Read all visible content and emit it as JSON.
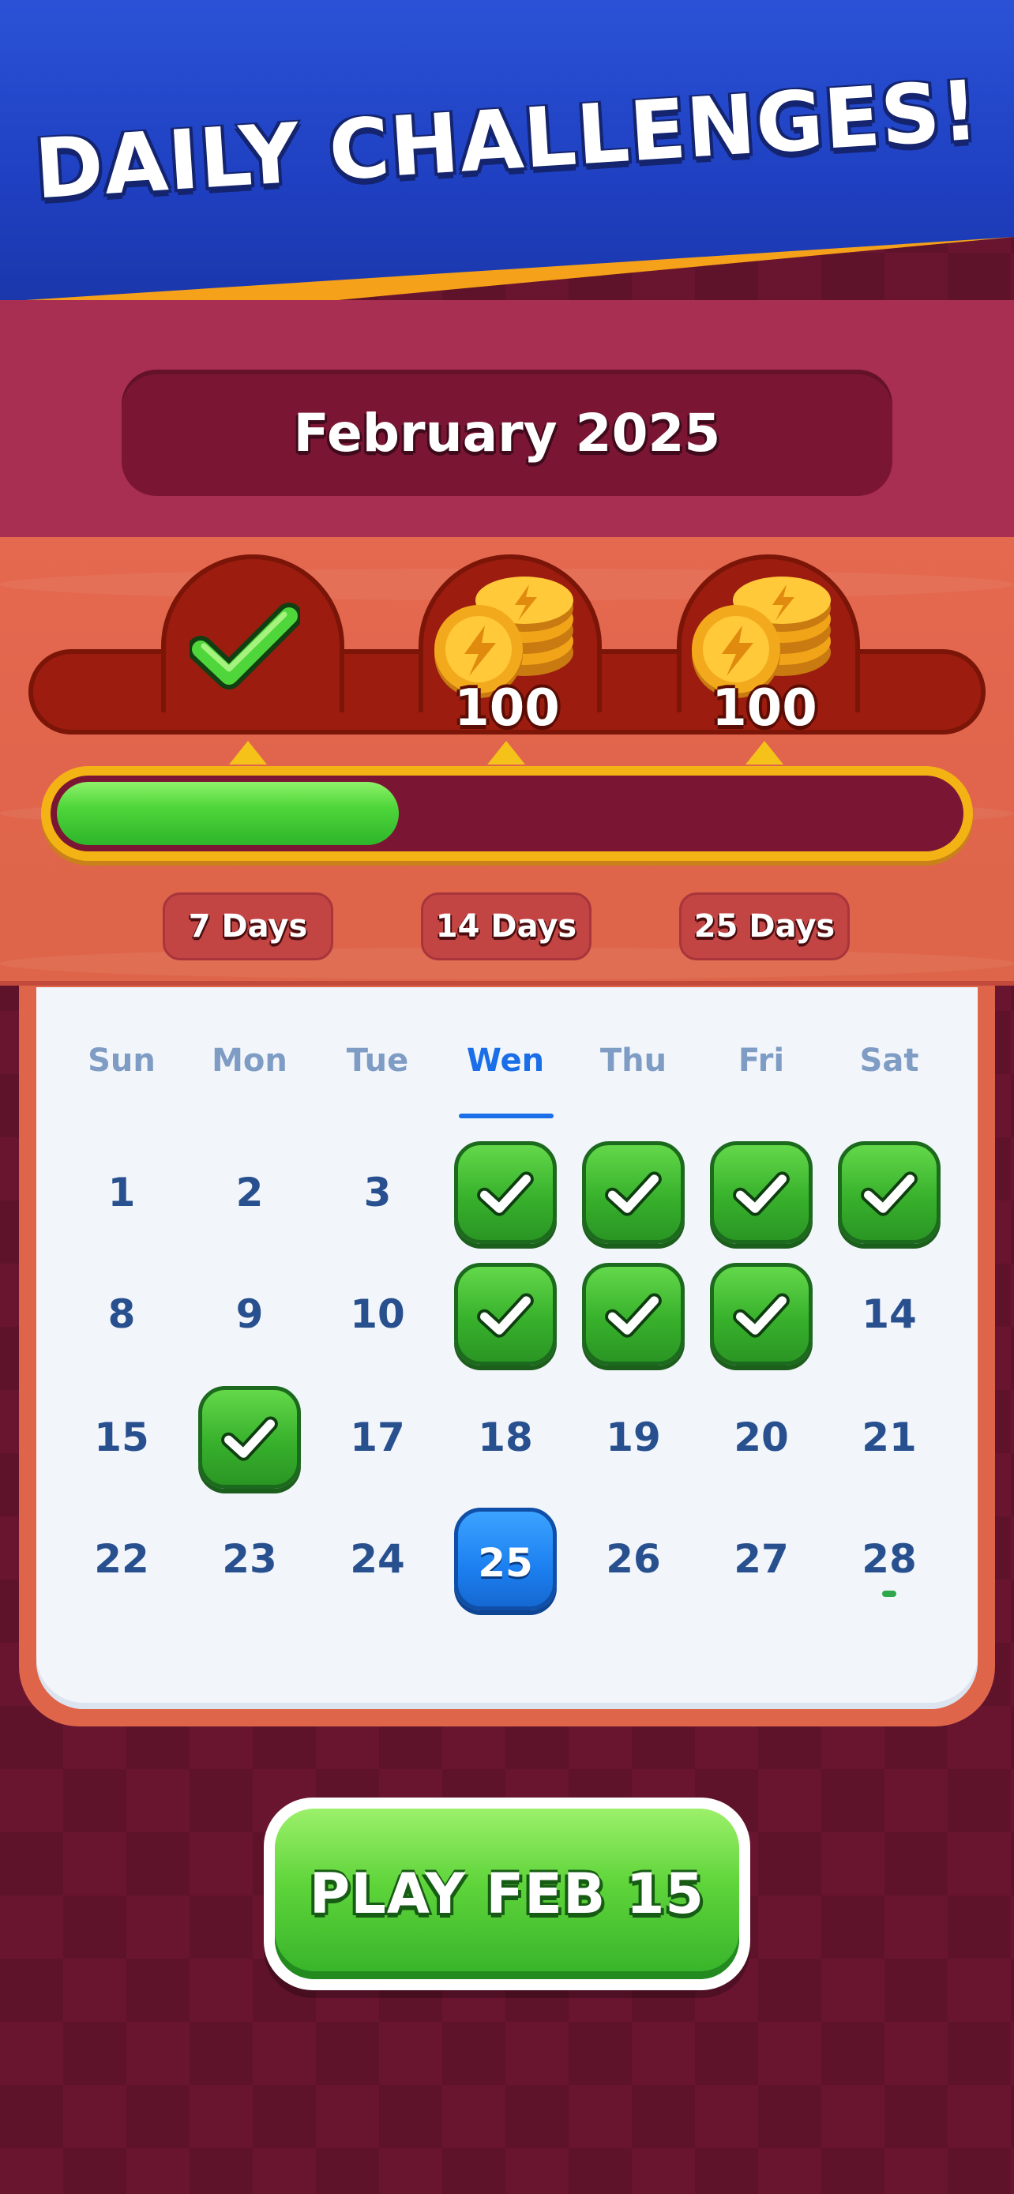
{
  "header": {
    "title": "DAILY CHALLENGES!"
  },
  "month": {
    "label": "February 2025"
  },
  "rewards": {
    "progress": 0.38,
    "milestones": [
      {
        "days_label": "7 Days",
        "reward": "check",
        "claimed": true
      },
      {
        "days_label": "14 Days",
        "reward": "coins",
        "amount": "100",
        "claimed": false
      },
      {
        "days_label": "25 Days",
        "reward": "coins",
        "amount": "100",
        "claimed": false
      }
    ]
  },
  "calendar": {
    "weekdays": [
      "Sun",
      "Mon",
      "Tue",
      "Wen",
      "Thu",
      "Fri",
      "Sat"
    ],
    "active_weekday": "Wen",
    "days": [
      {
        "label": "1",
        "state": "open"
      },
      {
        "label": "2",
        "state": "open"
      },
      {
        "label": "3",
        "state": "open"
      },
      {
        "label": "4",
        "state": "done"
      },
      {
        "label": "5",
        "state": "done"
      },
      {
        "label": "6",
        "state": "done"
      },
      {
        "label": "7",
        "state": "done"
      },
      {
        "label": "8",
        "state": "open"
      },
      {
        "label": "9",
        "state": "open"
      },
      {
        "label": "10",
        "state": "open"
      },
      {
        "label": "11",
        "state": "done"
      },
      {
        "label": "12",
        "state": "done"
      },
      {
        "label": "13",
        "state": "done"
      },
      {
        "label": "14",
        "state": "open"
      },
      {
        "label": "15",
        "state": "open"
      },
      {
        "label": "16",
        "state": "done"
      },
      {
        "label": "17",
        "state": "open"
      },
      {
        "label": "18",
        "state": "open"
      },
      {
        "label": "19",
        "state": "open"
      },
      {
        "label": "20",
        "state": "open"
      },
      {
        "label": "21",
        "state": "open"
      },
      {
        "label": "22",
        "state": "open"
      },
      {
        "label": "23",
        "state": "open"
      },
      {
        "label": "24",
        "state": "open"
      },
      {
        "label": "25",
        "state": "today"
      },
      {
        "label": "26",
        "state": "open"
      },
      {
        "label": "27",
        "state": "open"
      },
      {
        "label": "28",
        "state": "open",
        "marker": true
      }
    ]
  },
  "play_button": {
    "label": "PLAY FEB 15"
  },
  "colors": {
    "header_blue": "#1e3fc0",
    "accent_orange": "#f6a11a",
    "band_crimson": "#a92f52",
    "done_green": "#38b12c",
    "today_blue": "#1c7ff0",
    "weekday_active": "#1a6ee8"
  }
}
